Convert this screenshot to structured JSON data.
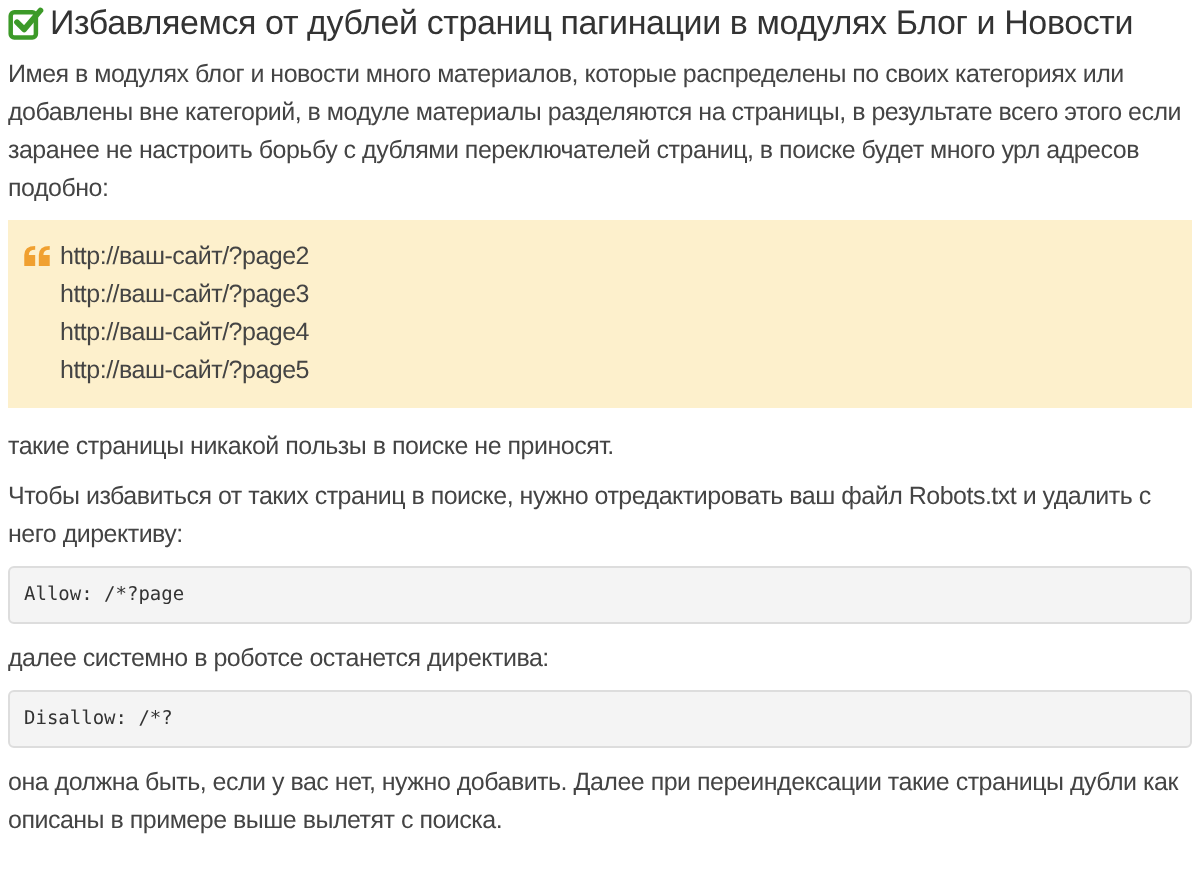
{
  "title": "Избавляемся от дублей страниц пагинации в модулях Блог и Новости",
  "blocks": [
    {
      "kind": "paragraph",
      "text": "Имея в модулях блог и новости много материалов, которые распределены по своих категориях или добавлены вне категорий, в модуле материалы разделяются на страницы, в результате всего этого если заранее не настроить борьбу с дублями переключателей страниц, в поиске будет много урл адресов подобно:"
    },
    {
      "kind": "quote",
      "lines": [
        "http://ваш-сайт/?page2",
        "http://ваш-сайт/?page3",
        "http://ваш-сайт/?page4",
        "http://ваш-сайт/?page5"
      ]
    },
    {
      "kind": "paragraph",
      "text": "такие страницы никакой пользы в поиске не приносят."
    },
    {
      "kind": "paragraph",
      "text": "Чтобы избавиться от таких страниц в поиске, нужно отредактировать ваш файл Robots.txt и удалить с него директиву:"
    },
    {
      "kind": "code",
      "text": "Allow: /*?page"
    },
    {
      "kind": "paragraph",
      "text": "далее системно в роботсе останется директива:"
    },
    {
      "kind": "code",
      "text": "Disallow: /*?"
    },
    {
      "kind": "paragraph",
      "text": "она должна быть, если у вас нет, нужно добавить. Далее при переиндексации такие страницы дубли как описаны в примере выше вылетят с поиска."
    }
  ]
}
